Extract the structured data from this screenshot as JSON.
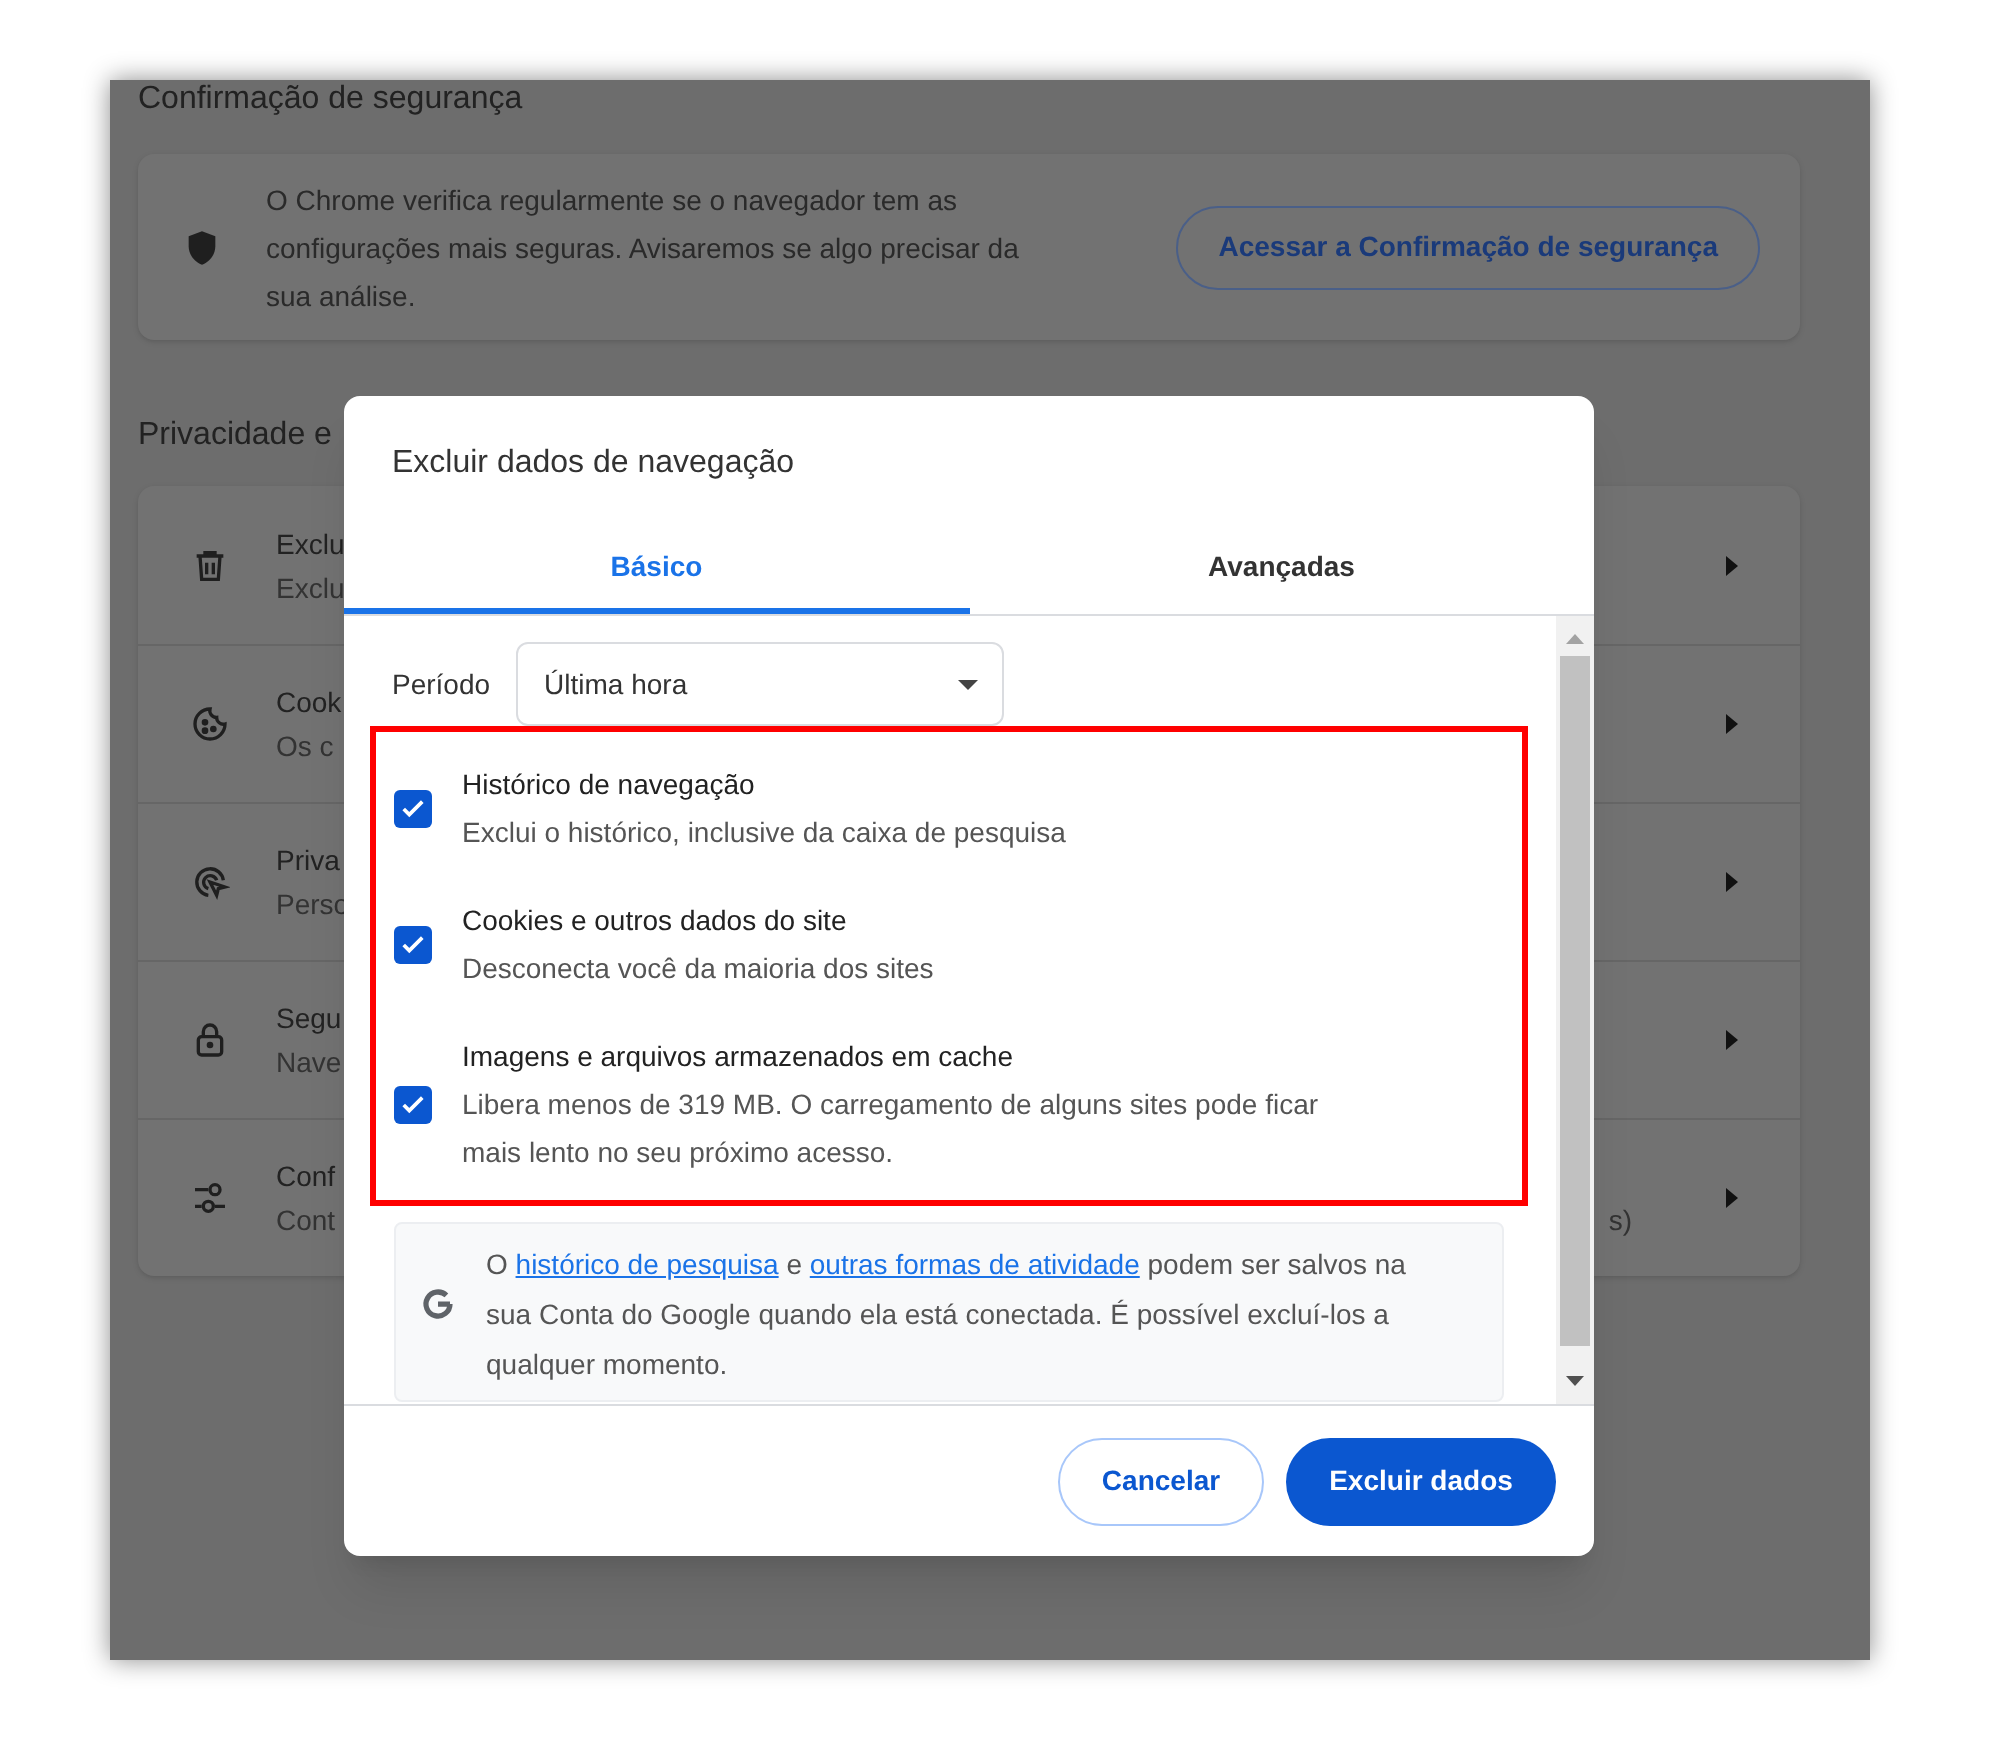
{
  "background": {
    "section_title": "Confirmação de segurança",
    "safety_card": {
      "text": "O Chrome verifica regularmente se o navegador tem as configurações mais seguras. Avisaremos se algo precisar da sua análise.",
      "button": "Acessar a Confirmação de segurança"
    },
    "privacy_title": "Privacidade e",
    "rows": [
      {
        "kind": "trash",
        "title": "Exclu",
        "subtitle": "Exclu"
      },
      {
        "kind": "cookie",
        "title": "Cook",
        "subtitle": "Os c"
      },
      {
        "kind": "privacy",
        "title": "Priva",
        "subtitle": "Perso"
      },
      {
        "kind": "lock",
        "title": "Segu",
        "subtitle": "Nave"
      },
      {
        "kind": "sliders",
        "title": "Conf",
        "subtitle": "Cont",
        "trailing": "s)"
      }
    ]
  },
  "dialog": {
    "title": "Excluir dados de navegação",
    "tabs": [
      {
        "label": "Básico",
        "selected": true
      },
      {
        "label": "Avançadas",
        "selected": false
      }
    ],
    "period": {
      "label": "Período",
      "value": "Última hora"
    },
    "options": [
      {
        "title": "Histórico de navegação",
        "description": "Exclui o histórico, inclusive da caixa de pesquisa",
        "checked": true
      },
      {
        "title": "Cookies e outros dados do site",
        "description": "Desconecta você da maioria dos sites",
        "checked": true
      },
      {
        "title": "Imagens e arquivos armazenados em cache",
        "description": "Libera menos de 319 MB. O carregamento de alguns sites pode ficar mais lento no seu próximo acesso.",
        "checked": true
      }
    ],
    "info": [
      {
        "text": "O ",
        "link": false
      },
      {
        "text": "histórico de pesquisa",
        "link": true
      },
      {
        "text": " e ",
        "link": false
      },
      {
        "text": "outras formas de atividade",
        "link": true
      },
      {
        "text": " podem ser salvos na sua Conta do Google quando ela está conectada. É possível excluí-los a qualquer momento.",
        "link": false
      }
    ],
    "buttons": {
      "cancel": "Cancelar",
      "confirm": "Excluir dados"
    }
  }
}
